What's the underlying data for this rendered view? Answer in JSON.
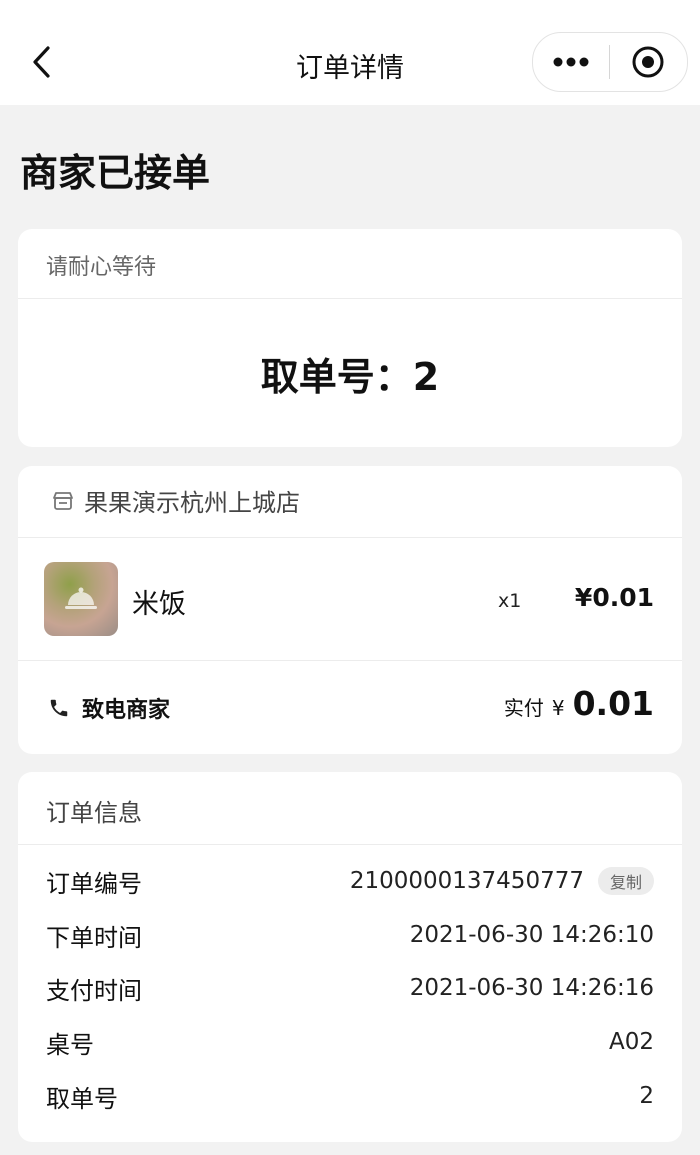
{
  "nav": {
    "title": "订单详情"
  },
  "status": {
    "title": "商家已接单"
  },
  "wait_card": {
    "message": "请耐心等待",
    "pickup_label": "取单号：2"
  },
  "order_card": {
    "store_name": "果果演示杭州上城店",
    "items": [
      {
        "name": "米饭",
        "qty": "x1",
        "price": "¥0.01"
      }
    ],
    "call_label": "致电商家",
    "paid_label": "实付",
    "paid_currency": "¥",
    "paid_amount": "0.01"
  },
  "info_card": {
    "title": "订单信息",
    "copy_label": "复制",
    "rows": [
      {
        "label": "订单编号",
        "value": "2100000137450777"
      },
      {
        "label": "下单时间",
        "value": "2021-06-30 14:26:10"
      },
      {
        "label": "支付时间",
        "value": "2021-06-30 14:26:16"
      },
      {
        "label": "桌号",
        "value": "A02"
      },
      {
        "label": "取单号",
        "value": "2"
      }
    ]
  },
  "icons": {
    "back": "chevron-left-icon",
    "more": "more-dots-icon",
    "close": "target-circle-icon",
    "store": "store-icon",
    "phone": "phone-icon",
    "food_placeholder": "cloche-icon"
  }
}
